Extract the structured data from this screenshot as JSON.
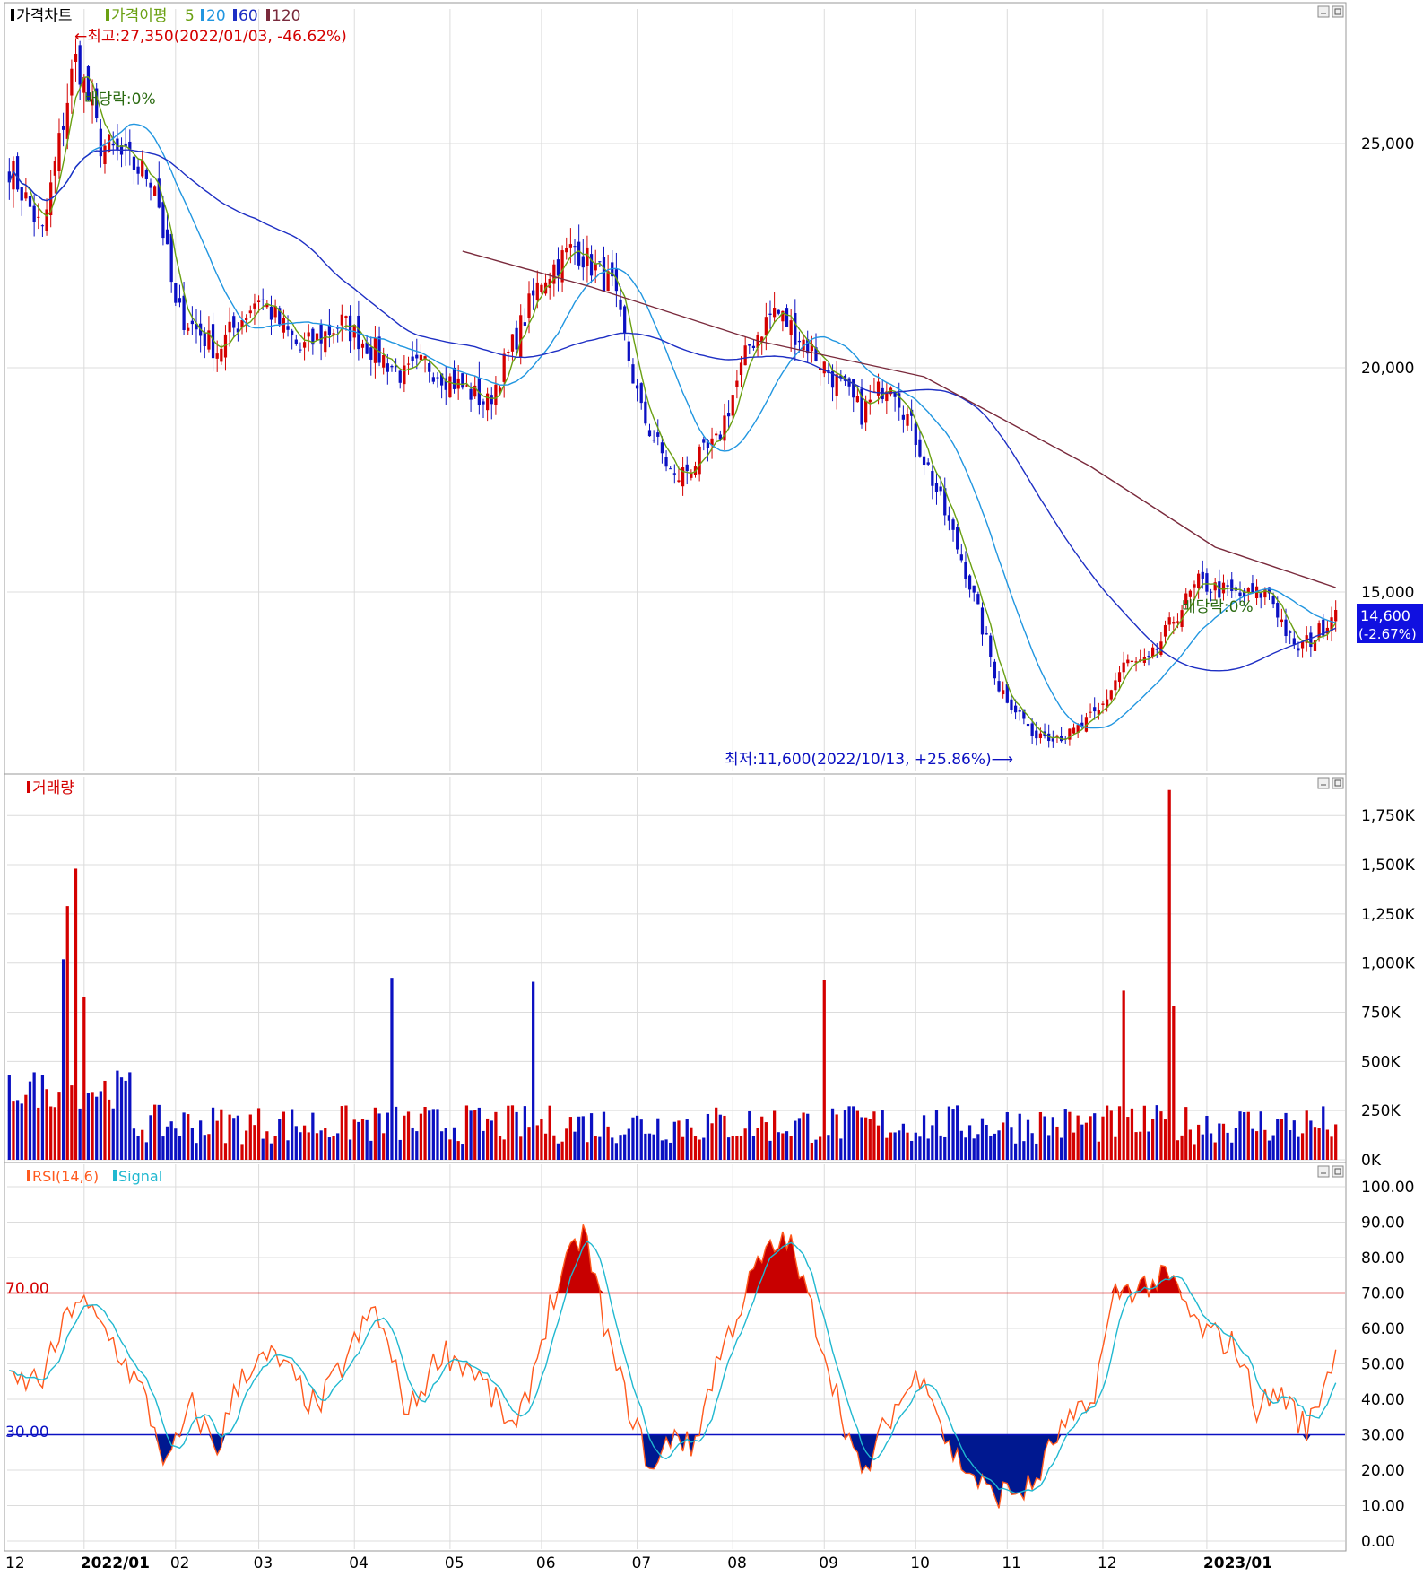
{
  "colors": {
    "up": "#d40000",
    "down": "#0b10c2",
    "ma5": "#6aa012",
    "ma20": "#2196e0",
    "ma60": "#1e2fc4",
    "ma120": "#7a2a3c",
    "rsi": "#ff5a1e",
    "signal": "#20b8d0",
    "overbought_fill": "#c80000",
    "oversold_fill": "#001890",
    "grid": "#dcdcdc",
    "panel_border": "#9a9a9a",
    "price_tag_bg": "#1010e0",
    "annotation_red": "#d40000",
    "annotation_blue": "#0b10c2",
    "annotation_green": "#2a6a10"
  },
  "icons": {
    "minimize": "minimize-icon",
    "maximize": "maximize-icon"
  },
  "price_panel": {
    "legend": {
      "title": "가격차트",
      "ma_label": "가격이평",
      "ma_items": [
        "5",
        "20",
        "60",
        "120"
      ]
    },
    "annotations": {
      "high": "←최고:27,350(2022/01/03, -46.62%)",
      "low": "최저:11,600(2022/10/13, +25.86%)⟶",
      "dividend_1": "배당락:0%",
      "dividend_2": "배당락:0%"
    },
    "current_price": "14,600",
    "current_change": "(-2.67%)"
  },
  "volume_panel": {
    "legend": {
      "title": "거래량"
    }
  },
  "rsi_panel": {
    "legend": {
      "rsi": "RSI(14,6)",
      "signal": "Signal"
    },
    "upper_label": "70.00",
    "lower_label": "30.00"
  },
  "chart_data": [
    {
      "type": "candlestick",
      "name": "price",
      "x_axis_labels": [
        "12",
        "2022/01",
        "02",
        "03",
        "04",
        "05",
        "06",
        "07",
        "08",
        "09",
        "10",
        "11",
        "12",
        "2023/01"
      ],
      "y_ticks": [
        "25,000",
        "20,000",
        "15,000"
      ],
      "ylim": [
        11000,
        28000
      ],
      "high": {
        "value": 27350,
        "date": "2022/01/03",
        "pct": "-46.62%"
      },
      "low": {
        "value": 11600,
        "date": "2022/10/13",
        "pct": "+25.86%"
      },
      "last_close": 14600,
      "ma_periods": [
        5,
        20,
        60,
        120
      ],
      "close_keypoints": [
        {
          "day": 0,
          "v": 24500
        },
        {
          "day": 8,
          "v": 23000
        },
        {
          "day": 16,
          "v": 27000
        },
        {
          "day": 22,
          "v": 25000
        },
        {
          "day": 35,
          "v": 24200
        },
        {
          "day": 40,
          "v": 21300
        },
        {
          "day": 50,
          "v": 20400
        },
        {
          "day": 60,
          "v": 21600
        },
        {
          "day": 70,
          "v": 20400
        },
        {
          "day": 80,
          "v": 21000
        },
        {
          "day": 95,
          "v": 19800
        },
        {
          "day": 100,
          "v": 20100
        },
        {
          "day": 115,
          "v": 19200
        },
        {
          "day": 128,
          "v": 22000
        },
        {
          "day": 136,
          "v": 22700
        },
        {
          "day": 145,
          "v": 21800
        },
        {
          "day": 152,
          "v": 19000
        },
        {
          "day": 160,
          "v": 17500
        },
        {
          "day": 170,
          "v": 18300
        },
        {
          "day": 178,
          "v": 20500
        },
        {
          "day": 184,
          "v": 21300
        },
        {
          "day": 192,
          "v": 20500
        },
        {
          "day": 205,
          "v": 19000
        },
        {
          "day": 212,
          "v": 19800
        },
        {
          "day": 220,
          "v": 18000
        },
        {
          "day": 230,
          "v": 15500
        },
        {
          "day": 238,
          "v": 12900
        },
        {
          "day": 246,
          "v": 11900
        },
        {
          "day": 255,
          "v": 11800
        },
        {
          "day": 262,
          "v": 12300
        },
        {
          "day": 268,
          "v": 13400
        },
        {
          "day": 274,
          "v": 13400
        },
        {
          "day": 280,
          "v": 14400
        },
        {
          "day": 286,
          "v": 15200
        },
        {
          "day": 296,
          "v": 14900
        },
        {
          "day": 303,
          "v": 15000
        },
        {
          "day": 309,
          "v": 13700
        },
        {
          "day": 314,
          "v": 14000
        },
        {
          "day": 319,
          "v": 14600
        }
      ],
      "ma120_keypoints": [
        {
          "day": 109,
          "v": 22600
        },
        {
          "day": 140,
          "v": 21800
        },
        {
          "day": 180,
          "v": 20600
        },
        {
          "day": 220,
          "v": 19800
        },
        {
          "day": 260,
          "v": 17800
        },
        {
          "day": 290,
          "v": 16000
        },
        {
          "day": 319,
          "v": 15100
        }
      ]
    },
    {
      "type": "bar",
      "name": "volume",
      "y_ticks": [
        "1,750K",
        "1,500K",
        "1,250K",
        "1,000K",
        "750K",
        "500K",
        "250K",
        "0K"
      ],
      "ylim": [
        0,
        1900
      ],
      "unit": "K",
      "spikes": [
        {
          "day": 13,
          "v": 1020
        },
        {
          "day": 14,
          "v": 1290
        },
        {
          "day": 16,
          "v": 1480
        },
        {
          "day": 18,
          "v": 830
        },
        {
          "day": 92,
          "v": 925
        },
        {
          "day": 126,
          "v": 905
        },
        {
          "day": 196,
          "v": 915
        },
        {
          "day": 268,
          "v": 860
        },
        {
          "day": 279,
          "v": 1880
        },
        {
          "day": 280,
          "v": 780
        }
      ]
    },
    {
      "type": "line",
      "name": "rsi",
      "series": [
        {
          "name": "RSI(14,6)"
        },
        {
          "name": "Signal"
        }
      ],
      "y_ticks": [
        "100.00",
        "90.00",
        "80.00",
        "70.00",
        "60.00",
        "50.00",
        "40.00",
        "30.00",
        "20.00",
        "10.00",
        "0.00"
      ],
      "ylim": [
        0,
        100
      ],
      "levels": [
        70,
        30
      ],
      "rsi_keypoints": [
        {
          "day": 0,
          "v": 44
        },
        {
          "day": 8,
          "v": 46
        },
        {
          "day": 16,
          "v": 69
        },
        {
          "day": 24,
          "v": 58
        },
        {
          "day": 32,
          "v": 42
        },
        {
          "day": 38,
          "v": 21
        },
        {
          "day": 44,
          "v": 38
        },
        {
          "day": 50,
          "v": 26
        },
        {
          "day": 56,
          "v": 48
        },
        {
          "day": 64,
          "v": 52
        },
        {
          "day": 74,
          "v": 37
        },
        {
          "day": 88,
          "v": 66
        },
        {
          "day": 96,
          "v": 36
        },
        {
          "day": 104,
          "v": 54
        },
        {
          "day": 112,
          "v": 48
        },
        {
          "day": 122,
          "v": 30
        },
        {
          "day": 130,
          "v": 66
        },
        {
          "day": 138,
          "v": 88
        },
        {
          "day": 145,
          "v": 52
        },
        {
          "day": 152,
          "v": 28
        },
        {
          "day": 155,
          "v": 19
        },
        {
          "day": 160,
          "v": 32
        },
        {
          "day": 164,
          "v": 25
        },
        {
          "day": 170,
          "v": 50
        },
        {
          "day": 180,
          "v": 78
        },
        {
          "day": 187,
          "v": 86
        },
        {
          "day": 195,
          "v": 58
        },
        {
          "day": 205,
          "v": 17
        },
        {
          "day": 212,
          "v": 36
        },
        {
          "day": 220,
          "v": 49
        },
        {
          "day": 226,
          "v": 26
        },
        {
          "day": 236,
          "v": 13
        },
        {
          "day": 246,
          "v": 15
        },
        {
          "day": 252,
          "v": 30
        },
        {
          "day": 260,
          "v": 38
        },
        {
          "day": 266,
          "v": 70
        },
        {
          "day": 272,
          "v": 72
        },
        {
          "day": 279,
          "v": 74
        },
        {
          "day": 286,
          "v": 60
        },
        {
          "day": 295,
          "v": 55
        },
        {
          "day": 300,
          "v": 38
        },
        {
          "day": 306,
          "v": 42
        },
        {
          "day": 312,
          "v": 31
        },
        {
          "day": 319,
          "v": 54
        }
      ]
    }
  ]
}
